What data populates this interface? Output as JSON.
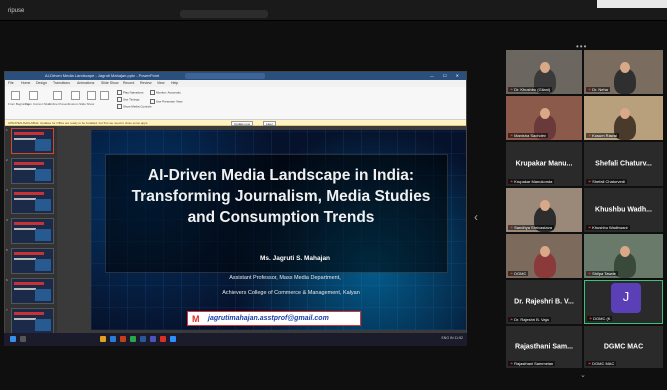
{
  "topbar": {
    "app_name": "ripuse"
  },
  "ppt": {
    "window_title": "AI-Driven Media Landscape - Jagruti Mahajan.pptx - PowerPoint",
    "menu": [
      "File",
      "Home",
      "Design",
      "Transitions",
      "Animations",
      "Slide Show",
      "Record",
      "Review",
      "View",
      "Help"
    ],
    "ribbon_buttons": [
      "From Beginning",
      "From Current Slide",
      "Online Present",
      "Custom Slide Show",
      "Set Up Slide Show",
      "Hide Slide",
      "Rehearse Timings",
      "Record"
    ],
    "ribbon_checks": [
      "Play Narrations",
      "Use Timings",
      "Show Media Controls",
      "Monitor: Automatic",
      "Use Presenter View"
    ],
    "notice": "UPDATES AVAILABLE: Updates for Office are ready to be installed, but first we need to close some apps.",
    "notice_buttons": [
      "Update now",
      "Later"
    ],
    "thumb_numbers": [
      "1",
      "2",
      "3",
      "4",
      "5",
      "6",
      "7"
    ],
    "status_left": "Slide 1 of 22   English (India)   Accessibility: Investigate",
    "status_right": "Notes   Comments   -  +  57%"
  },
  "slide": {
    "title": "AI-Driven Media Landscape in India: Transforming Journalism, Media Studies and Consumption Trends",
    "presenter": "Ms. Jagruti S. Mahajan",
    "role": "Assistant Professor, Mass Media Department,",
    "college": "Achievers College of Commerce & Management, Kalyan",
    "email_icon": "M",
    "email": "jagrutimahajan.asstprof@gmail.com"
  },
  "taskbar": {
    "tray": "ENG IN  11:52"
  },
  "participants": [
    {
      "label": "Dr. Khushbu (Gilani)"
    },
    {
      "label": "Dr. Neha"
    },
    {
      "label": "Manisha Sachdev"
    },
    {
      "label": "Kusum Rawal"
    },
    {
      "name": "Krupakar Manu...",
      "label": "Krupakar Manukonda"
    },
    {
      "name": "Shefali Chaturv...",
      "label": "Shefali Chaturvedi"
    },
    {
      "label": "Sandhya Shrivastava"
    },
    {
      "name": "Khushbu Wadh...",
      "label": "Khushbu Wadhwani"
    },
    {
      "label": "DGMC"
    },
    {
      "label": "Shilpa Tawde"
    },
    {
      "name": "Dr. Rajeshri B. V...",
      "label": "Dr. Rajeshri B. Vaja"
    },
    {
      "initial": "J",
      "label": "DGMC (K"
    },
    {
      "name": "Rajasthani Sam...",
      "label": "Rajasthani Sammelan"
    },
    {
      "name": "DGMC MAC",
      "label": "DGMC MAC"
    }
  ],
  "colors": {
    "accent": "#d93025",
    "email_text": "#1a3ea8",
    "avatar": "#5b3fb6",
    "active_border": "#3ec27a"
  }
}
